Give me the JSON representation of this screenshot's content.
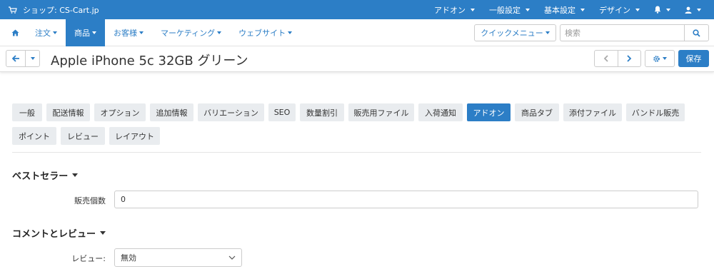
{
  "topbar": {
    "shop_label": "ショップ: CS-Cart.jp",
    "menus": [
      {
        "label": "アドオン"
      },
      {
        "label": "一般設定"
      },
      {
        "label": "基本設定"
      },
      {
        "label": "デザイン"
      }
    ]
  },
  "nav": {
    "items": [
      {
        "label": "注文"
      },
      {
        "label": "商品"
      },
      {
        "label": "お客様"
      },
      {
        "label": "マーケティング"
      },
      {
        "label": "ウェブサイト"
      }
    ],
    "quick_menu_label": "クイックメニュー",
    "search_placeholder": "検索"
  },
  "title_bar": {
    "product_title": "Apple iPhone 5c 32GB グリーン",
    "save_label": "保存"
  },
  "tabs": [
    {
      "label": "一般"
    },
    {
      "label": "配送情報"
    },
    {
      "label": "オプション"
    },
    {
      "label": "追加情報"
    },
    {
      "label": "バリエーション"
    },
    {
      "label": "SEO"
    },
    {
      "label": "数量割引"
    },
    {
      "label": "販売用ファイル"
    },
    {
      "label": "入荷通知"
    },
    {
      "label": "アドオン",
      "active": true
    },
    {
      "label": "商品タブ"
    },
    {
      "label": "添付ファイル"
    },
    {
      "label": "バンドル販売"
    },
    {
      "label": "ポイント"
    },
    {
      "label": "レビュー"
    },
    {
      "label": "レイアウト"
    }
  ],
  "sections": {
    "bestseller": {
      "title": "ベストセラー",
      "sales_label": "販売個数",
      "sales_value": "0"
    },
    "comments": {
      "title": "コメントとレビュー",
      "review_label": "レビュー:",
      "review_value": "無効"
    }
  },
  "colors": {
    "primary": "#2c7ec6",
    "tab_bg": "#e9ecef"
  }
}
